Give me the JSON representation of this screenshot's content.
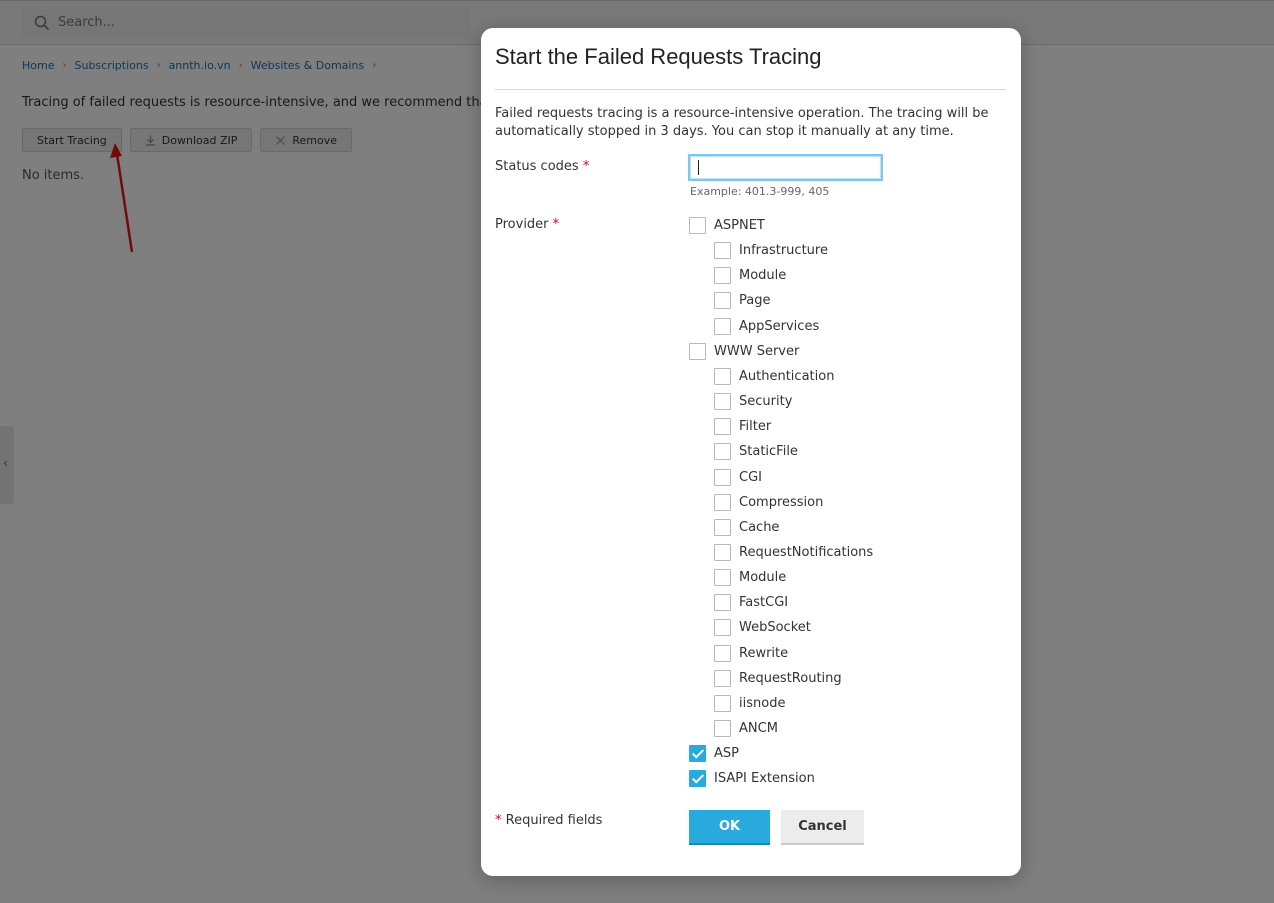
{
  "background": {
    "search_placeholder": "Search...",
    "breadcrumb": [
      "Home",
      "Subscriptions",
      "annth.io.vn",
      "Websites & Domains"
    ],
    "intro_text": "Tracing of failed requests is resource-intensive, and we recommend that you tu",
    "toolbar": {
      "start_tracing": "Start Tracing",
      "download_zip": "Download ZIP",
      "remove": "Remove"
    },
    "no_items": "No items.",
    "side_handle": "‹"
  },
  "modal": {
    "title": "Start the Failed Requests Tracing",
    "description": "Failed requests tracing is a resource-intensive operation. The tracing will be automatically stopped in 3 days. You can stop it manually at any time.",
    "status_codes": {
      "label": "Status codes",
      "required_mark": "*",
      "value": "",
      "hint": "Example: 401.3-999, 405"
    },
    "provider": {
      "label": "Provider",
      "required_mark": "*",
      "options": [
        {
          "label": "ASPNET",
          "level": 0,
          "checked": false
        },
        {
          "label": "Infrastructure",
          "level": 1,
          "checked": false
        },
        {
          "label": "Module",
          "level": 1,
          "checked": false
        },
        {
          "label": "Page",
          "level": 1,
          "checked": false
        },
        {
          "label": "AppServices",
          "level": 1,
          "checked": false
        },
        {
          "label": "WWW Server",
          "level": 0,
          "checked": false
        },
        {
          "label": "Authentication",
          "level": 1,
          "checked": false
        },
        {
          "label": "Security",
          "level": 1,
          "checked": false
        },
        {
          "label": "Filter",
          "level": 1,
          "checked": false
        },
        {
          "label": "StaticFile",
          "level": 1,
          "checked": false
        },
        {
          "label": "CGI",
          "level": 1,
          "checked": false
        },
        {
          "label": "Compression",
          "level": 1,
          "checked": false
        },
        {
          "label": "Cache",
          "level": 1,
          "checked": false
        },
        {
          "label": "RequestNotifications",
          "level": 1,
          "checked": false
        },
        {
          "label": "Module",
          "level": 1,
          "checked": false
        },
        {
          "label": "FastCGI",
          "level": 1,
          "checked": false
        },
        {
          "label": "WebSocket",
          "level": 1,
          "checked": false
        },
        {
          "label": "Rewrite",
          "level": 1,
          "checked": false
        },
        {
          "label": "RequestRouting",
          "level": 1,
          "checked": false
        },
        {
          "label": "iisnode",
          "level": 1,
          "checked": false
        },
        {
          "label": "ANCM",
          "level": 1,
          "checked": false
        },
        {
          "label": "ASP",
          "level": 0,
          "checked": true
        },
        {
          "label": "ISAPI Extension",
          "level": 0,
          "checked": true
        }
      ]
    },
    "required_note_mark": "*",
    "required_note": "Required fields",
    "ok_label": "OK",
    "cancel_label": "Cancel"
  },
  "colors": {
    "accent": "#28aade",
    "link": "#1f6fa8",
    "required": "#d0021b",
    "annotation_arrow": "#e8141b"
  }
}
